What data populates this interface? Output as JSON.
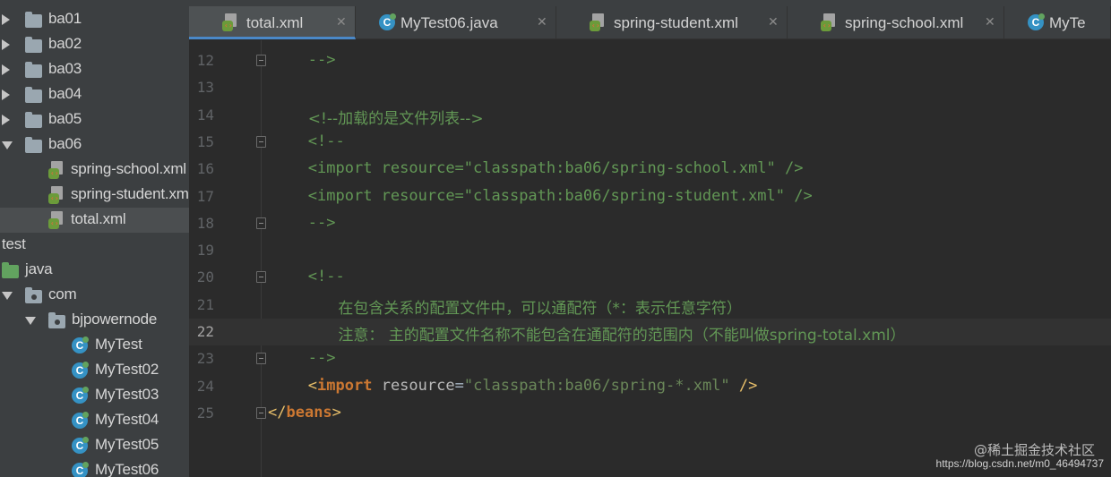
{
  "tree": {
    "items": [
      {
        "label": "ba01",
        "kind": "folder",
        "arrow": "right"
      },
      {
        "label": "ba02",
        "kind": "folder",
        "arrow": "right"
      },
      {
        "label": "ba03",
        "kind": "folder",
        "arrow": "right"
      },
      {
        "label": "ba04",
        "kind": "folder",
        "arrow": "right"
      },
      {
        "label": "ba05",
        "kind": "folder",
        "arrow": "right"
      },
      {
        "label": "ba06",
        "kind": "folder",
        "arrow": "down"
      },
      {
        "label": "spring-school.xml",
        "kind": "xml"
      },
      {
        "label": "spring-student.xml",
        "kind": "xml"
      },
      {
        "label": "total.xml",
        "kind": "xml",
        "selected": true
      },
      {
        "label": "test",
        "kind": "text"
      },
      {
        "label": "java",
        "kind": "source-folder"
      },
      {
        "label": "com",
        "kind": "package",
        "arrow": "down"
      },
      {
        "label": "bjpowernode",
        "kind": "package",
        "arrow": "down"
      },
      {
        "label": "MyTest",
        "kind": "class"
      },
      {
        "label": "MyTest02",
        "kind": "class"
      },
      {
        "label": "MyTest03",
        "kind": "class"
      },
      {
        "label": "MyTest04",
        "kind": "class"
      },
      {
        "label": "MyTest05",
        "kind": "class"
      },
      {
        "label": "MyTest06",
        "kind": "class"
      }
    ]
  },
  "tabs": [
    {
      "label": "total.xml",
      "icon": "xml-file-icon",
      "active": true
    },
    {
      "label": "MyTest06.java",
      "icon": "java-class-icon"
    },
    {
      "label": "spring-student.xml",
      "icon": "xml-file-icon"
    },
    {
      "label": "spring-school.xml",
      "icon": "xml-file-icon"
    },
    {
      "label": "MyTe",
      "icon": "java-class-icon"
    }
  ],
  "editor": {
    "current_line": "22",
    "lines": [
      {
        "no": "12",
        "fold": true,
        "indent": 4,
        "parts": [
          {
            "t": "-->",
            "c": "comment"
          }
        ]
      },
      {
        "no": "13",
        "parts": []
      },
      {
        "no": "14",
        "indent": 4,
        "parts": [
          {
            "t": "<!--加载的是文件列表-->",
            "c": "comment"
          }
        ]
      },
      {
        "no": "15",
        "fold": true,
        "indent": 4,
        "parts": [
          {
            "t": "<!--",
            "c": "comment"
          }
        ]
      },
      {
        "no": "16",
        "indent": 4,
        "parts": [
          {
            "t": "<import resource=\"classpath:ba06/spring-school.xml\" />",
            "c": "comment"
          }
        ]
      },
      {
        "no": "17",
        "indent": 4,
        "parts": [
          {
            "t": "<import resource=\"classpath:ba06/spring-student.xml\" />",
            "c": "comment"
          }
        ]
      },
      {
        "no": "18",
        "fold": true,
        "indent": 4,
        "parts": [
          {
            "t": "-->",
            "c": "comment"
          }
        ]
      },
      {
        "no": "19",
        "parts": []
      },
      {
        "no": "20",
        "fold": true,
        "indent": 4,
        "parts": [
          {
            "t": "<!--",
            "c": "comment"
          }
        ]
      },
      {
        "no": "21",
        "indent": 7,
        "parts": [
          {
            "t": "在包含关系的配置文件中，可以通配符（*：表示任意字符）",
            "c": "comment"
          }
        ]
      },
      {
        "no": "22",
        "indent": 7,
        "parts": [
          {
            "t": "注意： 主的配置文件名称不能包含在通配符的范围内（不能叫做spring-total.xml）",
            "c": "comment"
          }
        ]
      },
      {
        "no": "23",
        "fold": true,
        "indent": 4,
        "parts": [
          {
            "t": "-->",
            "c": "comment"
          }
        ]
      },
      {
        "no": "24",
        "indent": 4,
        "parts": [
          {
            "t": "<",
            "c": "bracket"
          },
          {
            "t": "import",
            "c": "kw"
          },
          {
            "t": " resource",
            "c": "attr"
          },
          {
            "t": "=",
            "c": "plain"
          },
          {
            "t": "\"classpath:ba06/spring-*.xml\"",
            "c": "str"
          },
          {
            "t": " />",
            "c": "bracket"
          }
        ]
      },
      {
        "no": "25",
        "fold": true,
        "indent": 0,
        "parts": [
          {
            "t": "</",
            "c": "bracket"
          },
          {
            "t": "beans",
            "c": "kw"
          },
          {
            "t": ">",
            "c": "bracket"
          }
        ]
      }
    ]
  },
  "watermark": {
    "line1": "@稀土掘金技术社区",
    "line2": "https://blog.csdn.net/m0_46494737"
  },
  "colors": {
    "comment": "#629755",
    "keyword": "#cc7832",
    "bracket": "#e8bf6a",
    "string": "#6a8759",
    "attribute": "#bababa",
    "active_tab_underline": "#4a88c7"
  }
}
